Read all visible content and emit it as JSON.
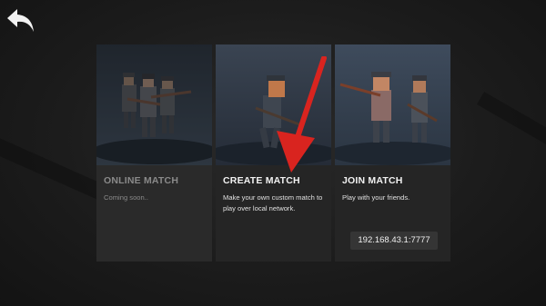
{
  "back": {
    "icon": "back-arrow-icon"
  },
  "cards": [
    {
      "title": "ONLINE MATCH",
      "description": "Coming soon..",
      "enabled": false
    },
    {
      "title": "CREATE MATCH",
      "description": "Make your own custom match to play over local network.",
      "enabled": true
    },
    {
      "title": "JOIN MATCH",
      "description": "Play with your friends.",
      "enabled": true,
      "ip": "192.168.43.1:7777"
    }
  ],
  "colors": {
    "pointer_arrow": "#d9241f",
    "card_bg": "#2b2b2b",
    "page_bg": "#1c1c1c"
  }
}
